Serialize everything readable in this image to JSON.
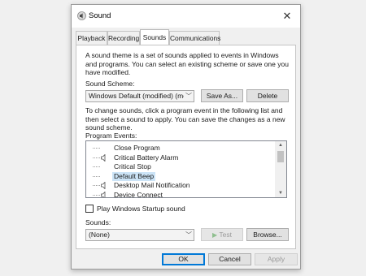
{
  "window": {
    "title": "Sound",
    "close_glyph": "✕"
  },
  "tabs": [
    {
      "label": "Playback"
    },
    {
      "label": "Recording"
    },
    {
      "label": "Sounds",
      "active": true
    },
    {
      "label": "Communications"
    }
  ],
  "intro": {
    "line1": "A sound theme is a set of sounds applied to events in Windows",
    "line2": "and programs.  You can select an existing scheme or save one you",
    "line3": "have modified."
  },
  "scheme": {
    "label": "Sound Scheme:",
    "value": "Windows Default (modified) (mc",
    "save_as": "Save As...",
    "delete": "Delete"
  },
  "instructions": {
    "line1": "To change sounds, click a program event in the following list and",
    "line2": "then select a sound to apply.  You can save the changes as a new",
    "line3": "sound scheme."
  },
  "events": {
    "label": "Program Events:",
    "items": [
      {
        "label": "Close Program",
        "speaker": false,
        "selected": false
      },
      {
        "label": "Critical Battery Alarm",
        "speaker": true,
        "selected": false
      },
      {
        "label": "Critical Stop",
        "speaker": false,
        "selected": false
      },
      {
        "label": "Default Beep",
        "speaker": false,
        "selected": true
      },
      {
        "label": "Desktop Mail Notification",
        "speaker": true,
        "selected": false
      },
      {
        "label": "Device Connect",
        "speaker": true,
        "selected": false
      }
    ]
  },
  "startup": {
    "label": "Play Windows Startup sound",
    "checked": false
  },
  "sounds": {
    "label": "Sounds:",
    "value": "(None)",
    "test": "Test",
    "browse": "Browse..."
  },
  "footer": {
    "ok": "OK",
    "cancel": "Cancel",
    "apply": "Apply"
  },
  "icons": {
    "speaker": "speaker-icon",
    "title": "sound-icon"
  },
  "colors": {
    "accent": "#0078d7",
    "selection": "#cce4f7"
  }
}
